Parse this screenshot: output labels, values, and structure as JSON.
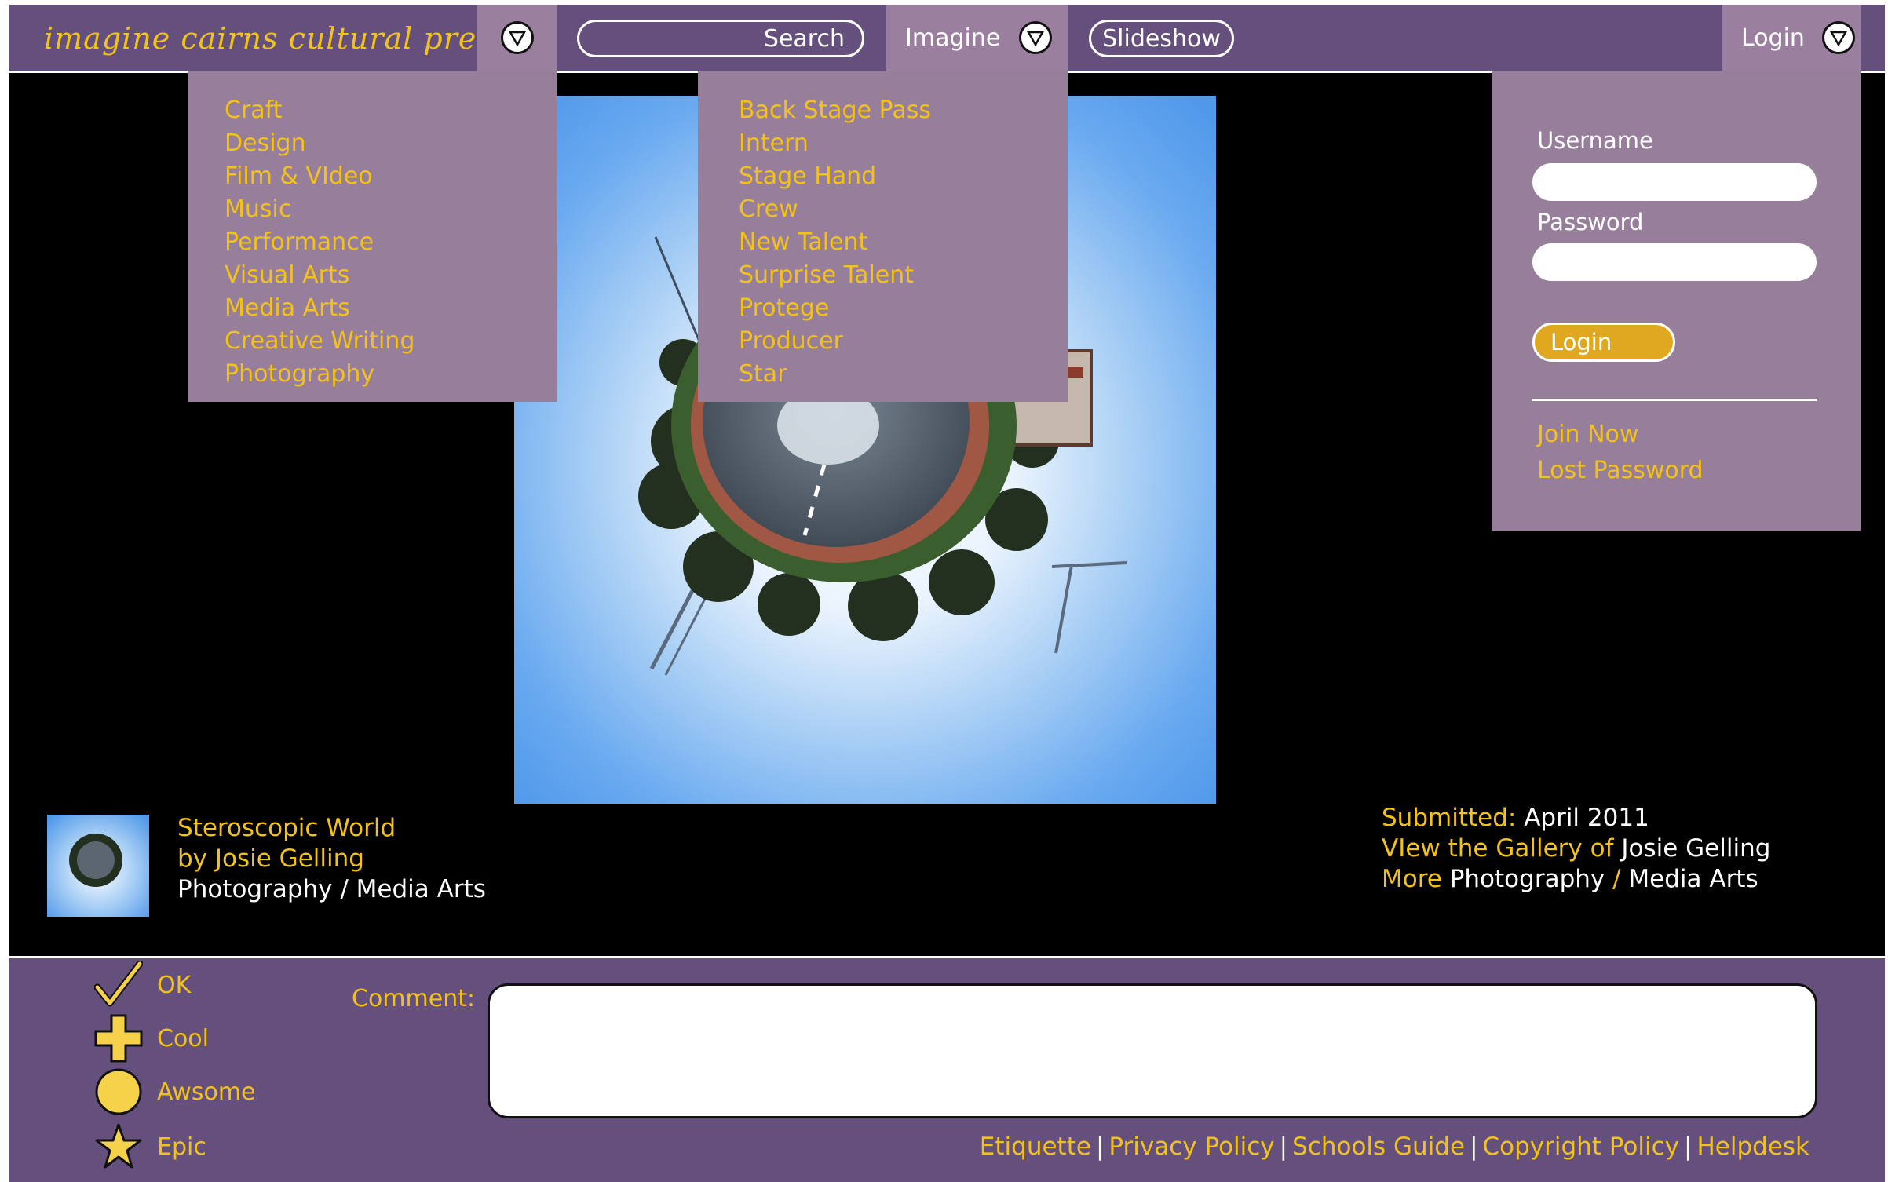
{
  "header": {
    "logo_text": "imagine cairns cultural precinct",
    "search": {
      "label": "Search"
    },
    "imagine_label": "Imagine",
    "slideshow_label": "Slideshow",
    "login_label": "Login",
    "icons": {
      "dropdown": "triangle-down-icon"
    }
  },
  "categories_menu": {
    "items": [
      "Craft",
      "Design",
      "Film & VIdeo",
      "Music",
      "Performance",
      "Visual Arts",
      "Media Arts",
      "Creative Writing",
      "Photography"
    ]
  },
  "imagine_menu": {
    "items": [
      "Back Stage Pass",
      "Intern",
      "Stage Hand",
      "Crew",
      "New Talent",
      "Surprise Talent",
      "Protege",
      "Producer",
      "Star"
    ]
  },
  "login_panel": {
    "username_label": "Username",
    "username_value": "",
    "password_label": "Password",
    "password_value": "",
    "login_button": "Login",
    "join_now": "Join Now",
    "lost_password": "Lost Password"
  },
  "artwork": {
    "title": "Steroscopic World",
    "by": "by Josie Gelling",
    "categories": "Photography / Media Arts"
  },
  "details": {
    "submitted_label": "Submitted:",
    "submitted_value": "April 2011",
    "gallery_label": "VIew the Gallery of",
    "gallery_value": "Josie Gelling",
    "more_label": "More",
    "more_cat1": "Photography",
    "more_sep": "/",
    "more_cat2": "Media Arts"
  },
  "ratings": [
    {
      "label": "OK",
      "icon": "checkmark-icon"
    },
    {
      "label": "Cool",
      "icon": "plus-icon"
    },
    {
      "label": "Awsome",
      "icon": "circle-icon"
    },
    {
      "label": "Epic",
      "icon": "star-icon"
    }
  ],
  "comment": {
    "label": "Comment:",
    "value": ""
  },
  "footer_links": [
    "Etiquette",
    "Privacy Policy",
    "Schools Guide",
    "Copyright Policy",
    "Helpdesk"
  ],
  "colors": {
    "bar": "#65507d",
    "menu": "#977e9b",
    "accent": "#f2c21a",
    "button": "#dfa81e",
    "background": "#000000"
  }
}
